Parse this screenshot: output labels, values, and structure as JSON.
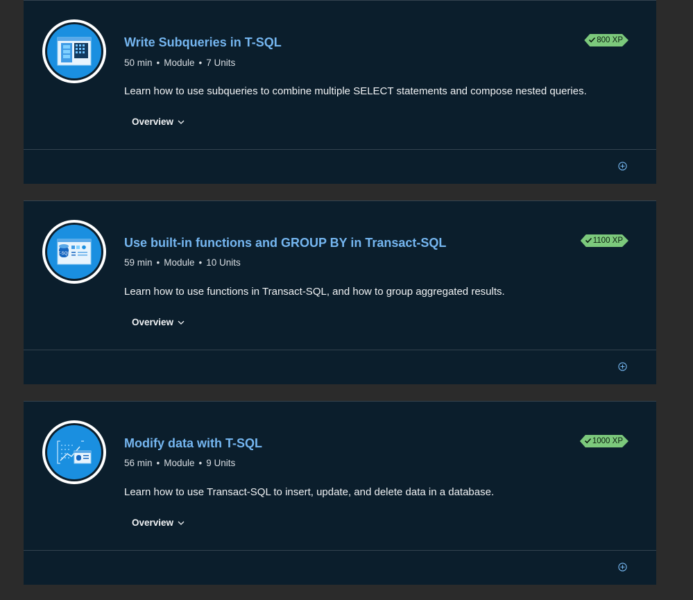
{
  "modules": [
    {
      "title": "Write Subqueries in T-SQL",
      "duration": "50 min",
      "type": "Module",
      "units": "7 Units",
      "description": "Learn how to use subqueries to combine multiple SELECT statements and compose nested queries.",
      "overview": "Overview",
      "xp": "800 XP",
      "icon": "subquery-icon"
    },
    {
      "title": "Use built-in functions and GROUP BY in Transact-SQL",
      "duration": "59 min",
      "type": "Module",
      "units": "10 Units",
      "description": "Learn how to use functions in Transact-SQL, and how to group aggregated results.",
      "overview": "Overview",
      "xp": "1100 XP",
      "icon": "tsql-functions-icon"
    },
    {
      "title": "Modify data with T-SQL",
      "duration": "56 min",
      "type": "Module",
      "units": "9 Units",
      "description": "Learn how to use Transact-SQL to insert, update, and delete data in a database.",
      "overview": "Overview",
      "xp": "1000 XP",
      "icon": "modify-data-icon"
    }
  ],
  "colors": {
    "background": "#2b2b2b",
    "card": "#0b1e2c",
    "title": "#75b6f0",
    "xp_badge": "#7cc97c"
  }
}
